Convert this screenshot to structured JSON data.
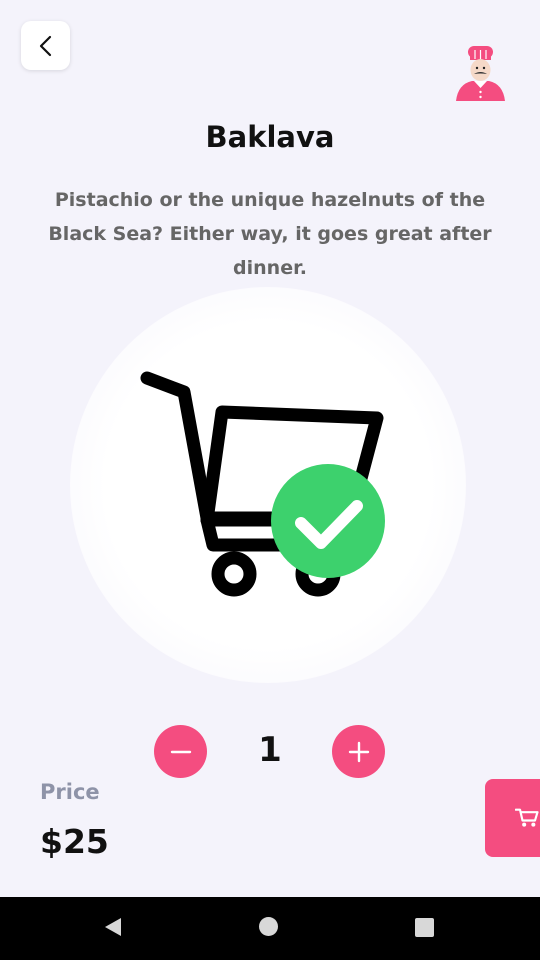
{
  "header": {
    "back_icon": "chevron-left-icon",
    "avatar_icon": "chef-icon"
  },
  "product": {
    "name": "Baklava",
    "description": "Pistachio or the unique hazelnuts of the Black Sea? Either way, it goes great after dinner.",
    "image_icon": "cart-check-icon"
  },
  "quantity": {
    "value": "1",
    "decrease_icon": "minus-icon",
    "increase_icon": "plus-icon"
  },
  "price": {
    "label": "Price",
    "value": "$25"
  },
  "actions": {
    "add_to_cart_icon": "cart-icon"
  },
  "colors": {
    "accent": "#f44d80",
    "success": "#3dd16d",
    "background": "#f4f3fb"
  },
  "system_nav": {
    "icons": [
      "back-triangle-icon",
      "home-circle-icon",
      "recents-square-icon"
    ]
  }
}
